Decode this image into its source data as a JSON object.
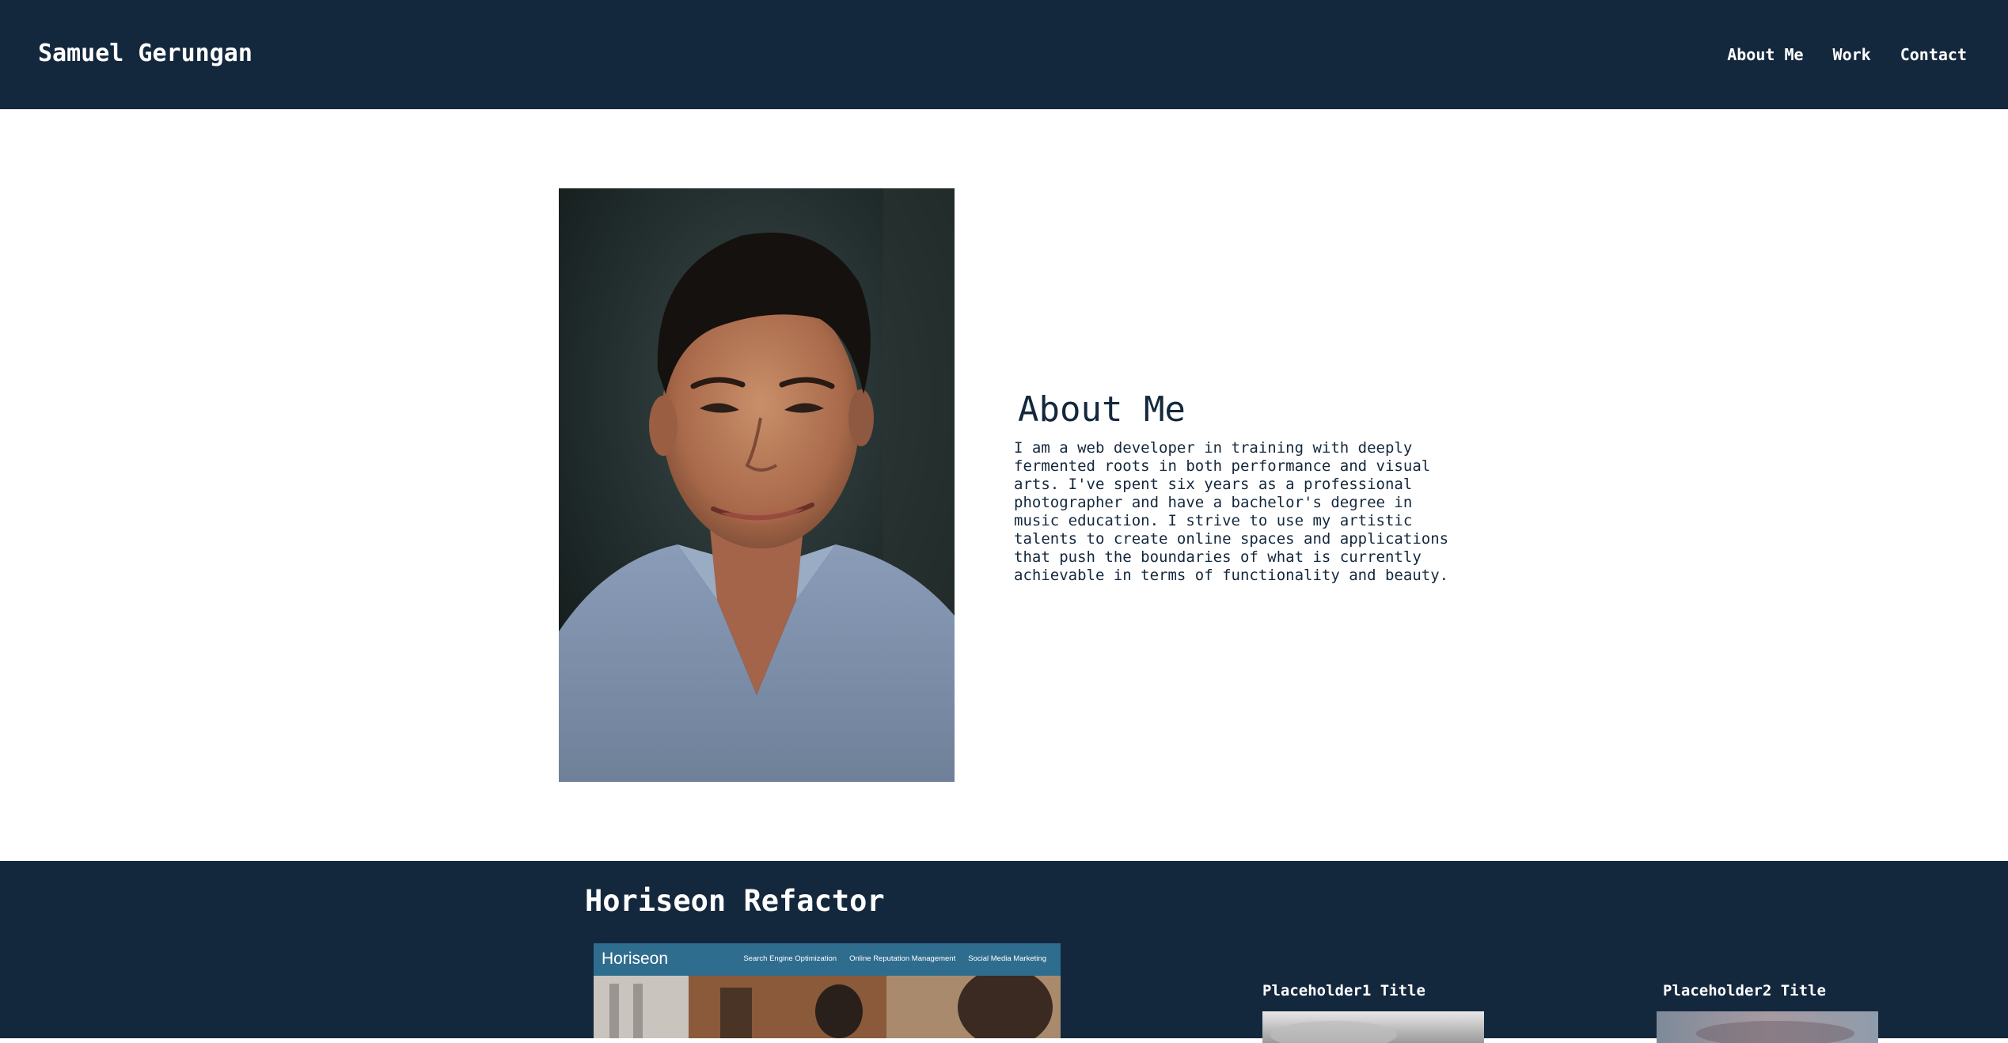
{
  "header": {
    "brand": "Samuel Gerungan",
    "nav": [
      {
        "label": "About Me"
      },
      {
        "label": "Work"
      },
      {
        "label": "Contact"
      }
    ]
  },
  "about": {
    "title": "About Me",
    "text": "I am a web developer in training with deeply fermented roots in both performance and visual arts. I've spent six years as a professional photographer and have a bachelor's degree in music education. I strive to use my artistic talents to create online spaces and applications that push the boundaries of what is currently achievable in terms of functionality and beauty."
  },
  "work": {
    "title": "Horiseon Refactor",
    "project_preview": {
      "logo": "Horiseon",
      "nav": [
        "Search Engine Optimization",
        "Online Reputation Management",
        "Social Media Marketing"
      ]
    },
    "placeholders": [
      {
        "title": "Placeholder1 Title"
      },
      {
        "title": "Placeholder2 Title"
      }
    ]
  },
  "colors": {
    "navy": "#14283d",
    "white": "#ffffff",
    "preview_bar": "#2f6d8e"
  }
}
